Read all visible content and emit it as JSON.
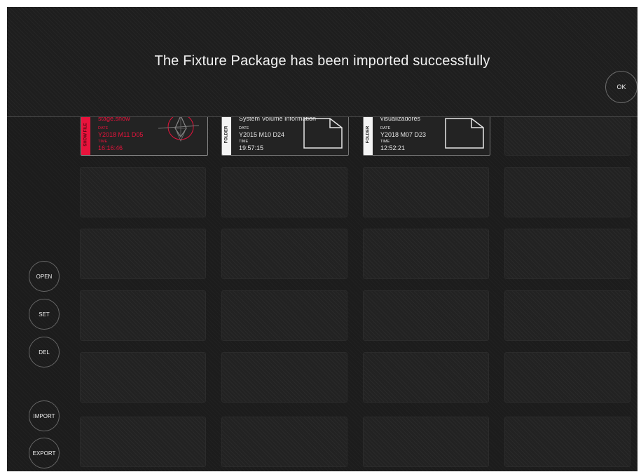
{
  "banner": {
    "message": "The Fixture Package has been imported successfully",
    "ok_label": "OK"
  },
  "cards": [
    {
      "type_tag": "SHOW FILE",
      "name": "stage.show",
      "date_label": "DATE",
      "date": "Y2018 M11 D05",
      "time_label": "TIME",
      "time": "16:16:46",
      "accent": "#e8133c"
    },
    {
      "type_tag": "FOLDER",
      "name": "System Volume Information",
      "date_label": "DATE",
      "date": "Y2015 M10 D24",
      "time_label": "TIME",
      "time": "19:57:15"
    },
    {
      "type_tag": "FOLDER",
      "name": "visualizadores",
      "date_label": "DATE",
      "date": "Y2018 M07 D23",
      "time_label": "TIME",
      "time": "12:52:21"
    }
  ],
  "side_buttons": {
    "open": "OPEN",
    "set": "SET",
    "del": "DEL",
    "import": "IMPORT",
    "export": "EXPORT"
  }
}
